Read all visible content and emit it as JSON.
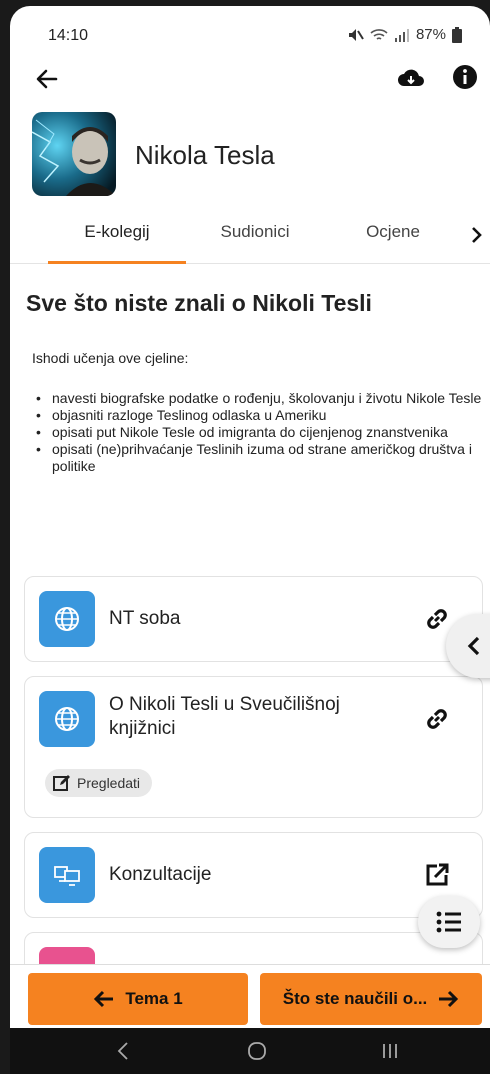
{
  "status_bar": {
    "time": "14:10",
    "battery": "87%"
  },
  "header": {
    "title": "Nikola Tesla"
  },
  "tabs": [
    {
      "label": "E-kolegij",
      "active": true
    },
    {
      "label": "Sudionici",
      "active": false
    },
    {
      "label": "Ocjene",
      "active": false
    }
  ],
  "section": {
    "title": "Sve što niste znali o Nikoli Tesli",
    "intro": "Ishodi učenja ove cjeline:",
    "outcomes": [
      "navesti biografske podatke o rođenju, školovanju i životu Nikole Tesle",
      "objasniti razloge Teslinog odlaska u Ameriku",
      "opisati put Nikole Tesle od imigranta do cijenjenog znanstvenika",
      "opisati (ne)prihvaćanje Teslinih izuma od strane američkog društva i politike"
    ]
  },
  "cards": [
    {
      "title": "NT soba",
      "icon": "globe-icon",
      "action_icon": "link-icon"
    },
    {
      "title": "O Nikoli Tesli u Sveučilišnoj knjižnici",
      "icon": "globe-icon",
      "action_icon": "link-icon",
      "badge": "Pregledati"
    },
    {
      "title": "Konzultacije",
      "icon": "computers-icon",
      "action_icon": "external-link-icon"
    }
  ],
  "bottom_nav": {
    "prev_label": "Tema 1",
    "next_label": "Što ste naučili o..."
  },
  "colors": {
    "accent": "#f58220",
    "icon_blue": "#3a97dd",
    "icon_pink": "#e8528f"
  }
}
